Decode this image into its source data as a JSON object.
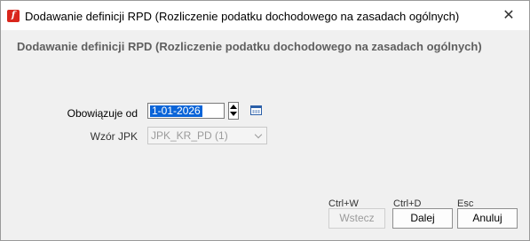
{
  "window": {
    "title": "Dodawanie definicji RPD (Rozliczenie podatku dochodowego na zasadach ogólnych)",
    "close_glyph": "✕",
    "app_icon_letter": "f"
  },
  "header": {
    "text": "Dodawanie definicji RPD (Rozliczenie podatku dochodowego na zasadach ogólnych)"
  },
  "form": {
    "date_label": "Obowiązuje od",
    "date_value": "1-01-2026",
    "template_label": "Wzór JPK",
    "template_value": "JPK_KR_PD (1)"
  },
  "buttons": {
    "back": {
      "hotkey": "Ctrl+W",
      "label": "Wstecz",
      "enabled": false
    },
    "next": {
      "hotkey": "Ctrl+D",
      "label": "Dalej",
      "enabled": true
    },
    "cancel": {
      "hotkey": "Esc",
      "label": "Anuluj",
      "enabled": true
    }
  },
  "colors": {
    "app_icon": "#d9261c",
    "selection": "#0a64d8",
    "calendar_icon": "#2b5fa8"
  },
  "icons": {
    "app": "app-logo-icon",
    "close": "close-icon",
    "calendar": "calendar-icon",
    "spin_up": "arrow-up-icon",
    "spin_down": "arrow-down-icon",
    "dropdown": "chevron-down-icon"
  }
}
